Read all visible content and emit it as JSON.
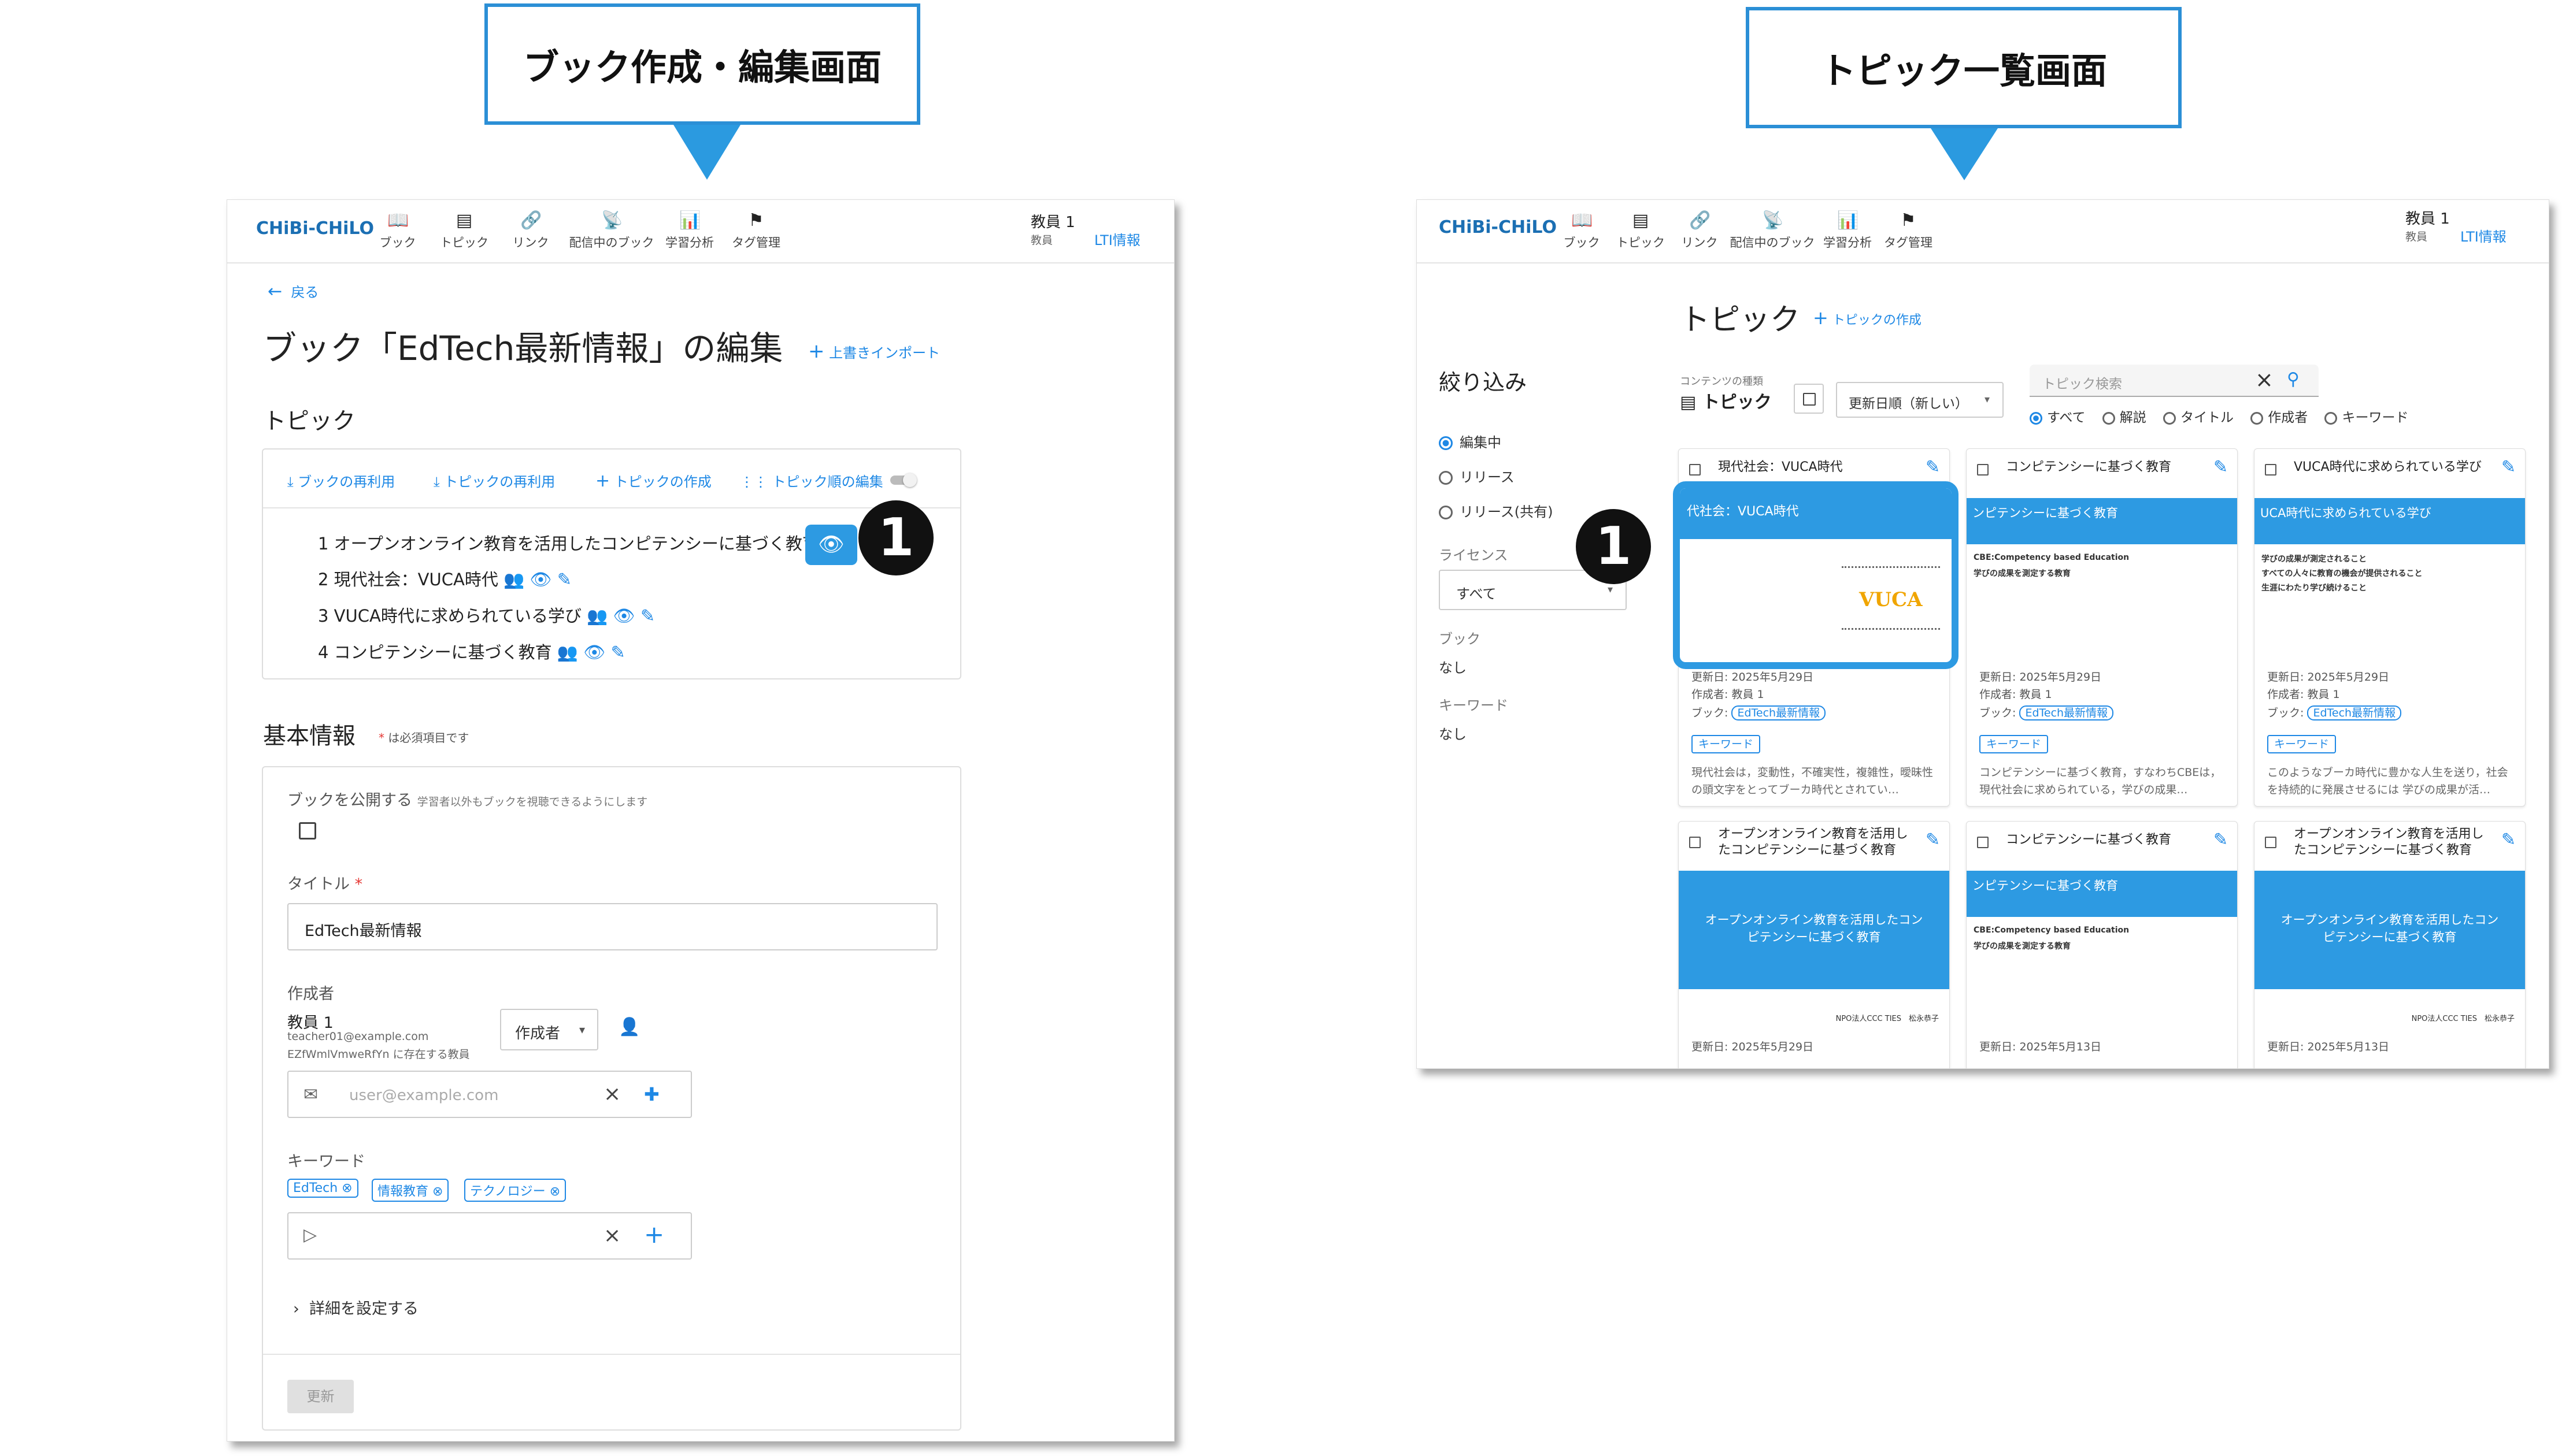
{
  "callouts": {
    "left": "ブック作成・編集画面",
    "right": "トピック一覧画面"
  },
  "header": {
    "logo": "CHiBi-CHiLO",
    "nav": [
      "ブック",
      "トピック",
      "リンク",
      "配信中のブック",
      "学習分析",
      "タグ管理"
    ],
    "user_name": "教員 1",
    "user_role": "教員",
    "lti": "LTI情報"
  },
  "editor": {
    "back": "戻る",
    "title": "ブック「EdTech最新情報」の編集",
    "import": "上書きインポート",
    "topics_heading": "トピック",
    "actions": [
      "ブックの再利用",
      "トピックの再利用",
      "トピックの作成",
      "トピック順の編集"
    ],
    "topics": [
      "1 オープンオンライン教育を活用したコンピテンシーに基づく教育",
      "2 現代社会：VUCA時代",
      "3 VUCA時代に求められている学び",
      "4 コンピテンシーに基づく教育"
    ],
    "basic_heading": "基本情報",
    "required_note": "は必須項目です",
    "publish_label": "ブックを公開する",
    "publish_hint": "学習者以外もブックを視聴できるようにします",
    "title_label": "タイトル",
    "title_value": "EdTech最新情報",
    "author_label": "作成者",
    "author_name": "教員 1",
    "author_email": "teacher01@example.com",
    "author_org": "EZfWmlVmweRfYn に存在する教員",
    "author_role": "作成者",
    "email_placeholder": "user@example.com",
    "keyword_label": "キーワード",
    "keywords": [
      "EdTech",
      "情報教育",
      "テクノロジー"
    ],
    "detail": "詳細を設定する",
    "update": "更新",
    "badge": "1"
  },
  "list": {
    "title": "トピック",
    "create": "トピックの作成",
    "filter_heading": "絞り込み",
    "filter_status": [
      "編集中",
      "リリース",
      "リリース(共有)"
    ],
    "license_label": "ライセンス",
    "license_value": "すべて",
    "book_label": "ブック",
    "book_value": "なし",
    "keyword_label": "キーワード",
    "keyword_value": "なし",
    "content_type_label": "コンテンツの種類",
    "content_type_value": "トピック",
    "sort": "更新日順（新しい）",
    "search_placeholder": "トピック検索",
    "search_scope": [
      "すべて",
      "解説",
      "タイトル",
      "作成者",
      "キーワード"
    ],
    "badge": "1",
    "cards": [
      {
        "title": "現代社会：VUCA時代",
        "band": "代社会：VUCA時代",
        "updated": "更新日: 2025年5月29日",
        "author": "作成者: 教員 1",
        "book": "ブック:",
        "book_chip": "EdTech最新情報",
        "kw": "キーワード",
        "desc": "現代社会は，変動性，不確実性，複雑性，曖昧性 の頭文字をとってブーカ時代とされてい…"
      },
      {
        "title": "コンピテンシーに基づく教育",
        "band": "ンピテンシーに基づく教育",
        "l1": "CBE:Competency based Education",
        "l2": "学びの成果を測定する教育",
        "updated": "更新日: 2025年5月29日",
        "author": "作成者: 教員 1",
        "book": "ブック:",
        "book_chip": "EdTech最新情報",
        "kw": "キーワード",
        "desc": "コンピテンシーに基づく教育，すなわちCBEは，現代社会に求められている，学びの成果…"
      },
      {
        "title": "VUCA時代に求められている学び",
        "band": "UCA時代に求められている学び",
        "l1": "学びの成果が測定されること",
        "l2": "すべての人々に教育の機会が提供されること",
        "l3": "生涯にわたり学び続けること",
        "updated": "更新日: 2025年5月29日",
        "author": "作成者: 教員 1",
        "book": "ブック:",
        "book_chip": "EdTech最新情報",
        "kw": "キーワード",
        "desc": "このようなブーカ時代に豊かな人生を送り，社会を持続的に発展させるには 学びの成果が活…"
      },
      {
        "title": "オープンオンライン教育を活用したコンピテンシーに基づく教育",
        "band": "オープンオンライン教育を活用したコンピテンシーに基づく教育",
        "org": "NPO法人CCC TIES　松永恭子",
        "updated": "更新日: 2025年5月29日"
      },
      {
        "title": "コンピテンシーに基づく教育",
        "band": "ンピテンシーに基づく教育",
        "l1": "CBE:Competency based Education",
        "l2": "学びの成果を測定する教育",
        "updated": "更新日: 2025年5月13日"
      },
      {
        "title": "オープンオンライン教育を活用したコンピテンシーに基づく教育",
        "band": "オープンオンライン教育を活用したコンピテンシーに基づく教育",
        "org": "NPO法人CCC TIES　松永恭子",
        "updated": "更新日: 2025年5月13日"
      }
    ]
  },
  "colors": {
    "accent": "#1e88e5",
    "callout_border": "#2b8fd6",
    "band": "#2d9ae2"
  }
}
